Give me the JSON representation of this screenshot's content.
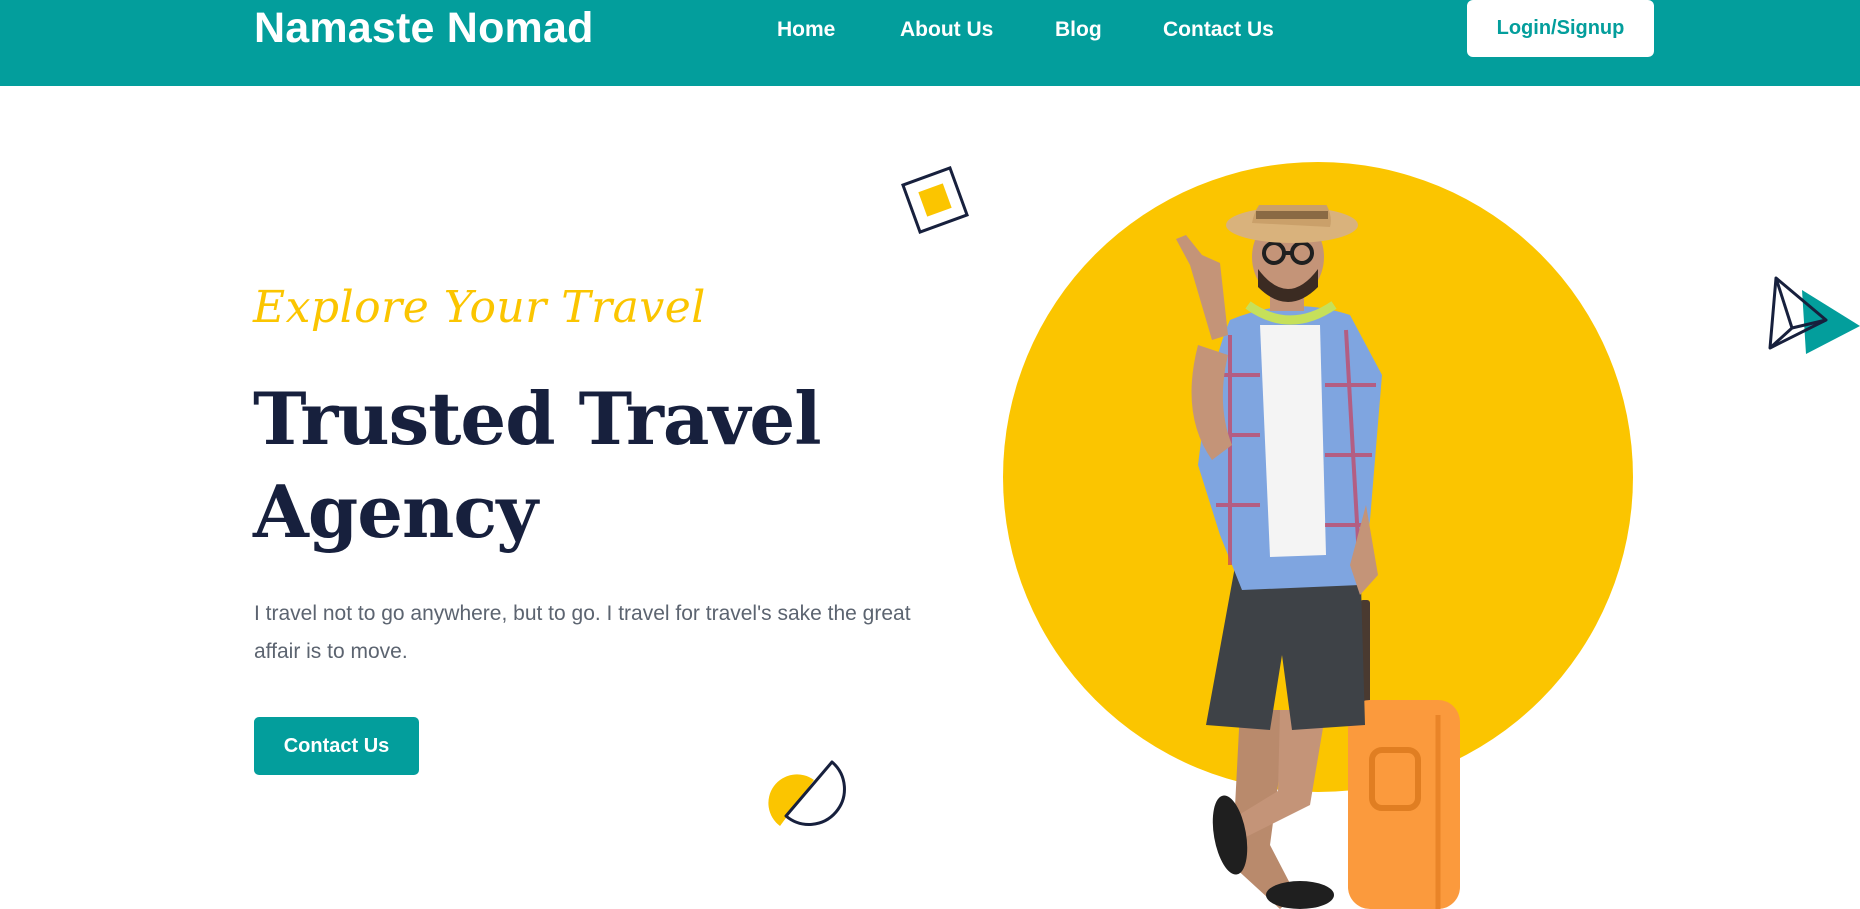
{
  "header": {
    "brand": "Namaste Nomad",
    "nav": [
      {
        "label": "Home"
      },
      {
        "label": "About Us"
      },
      {
        "label": "Blog"
      },
      {
        "label": "Contact Us"
      }
    ],
    "login_label": "Login/Signup"
  },
  "hero": {
    "tagline": "Explore Your Travel",
    "headline": "Trusted Travel Agency",
    "intro": "I travel not to go anywhere, but to go. I travel for travel's sake the great affair is to move.",
    "cta_label": "Contact Us"
  },
  "colors": {
    "primary": "#039e9c",
    "accent": "#fbc500",
    "heading": "#17203d",
    "body_text": "#5c6470"
  },
  "decorations": [
    "square-diamond-icon",
    "half-circle-icon",
    "paper-plane-icon"
  ]
}
